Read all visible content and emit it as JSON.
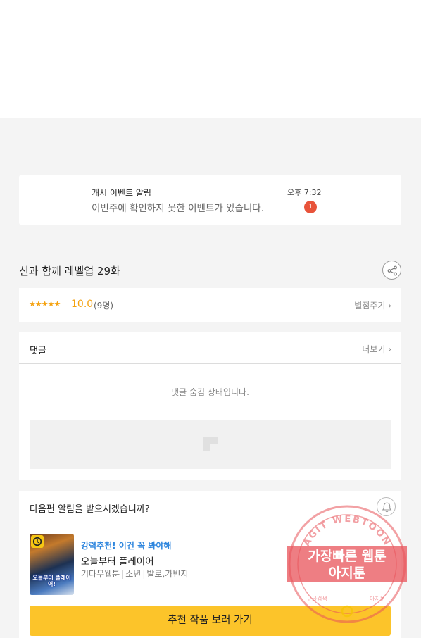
{
  "notification": {
    "title": "캐시 이벤트 알림",
    "body": "이번주에 확인하지 못한 이벤트가 있습니다.",
    "time": "오후 7:32",
    "badge": "1"
  },
  "episode": {
    "title": "신과 함께 레벨업 29화",
    "share_icon": "share-icon"
  },
  "rating": {
    "stars": "★★★★★",
    "score": "10.0",
    "count": "(9명)",
    "rate_link": "별점주기 ›"
  },
  "comments": {
    "title": "댓글",
    "more": "더보기 ›",
    "hidden_message": "댓글 숨김 상태입니다."
  },
  "next_alert": {
    "question": "다음편 알림을 받으시겠습니까?",
    "bell_icon": "bell-icon",
    "thumbnail_text": "오늘부터 플레이어!",
    "tag": "강력추천! 이건 꼭 봐야해",
    "title": "오늘부터 플레이어",
    "genres": [
      "기다무웹툰",
      "소년",
      "발로,가빈지"
    ],
    "cta": "추천 작품 보러 가기"
  },
  "watermark": {
    "top_text": "AGIT WEBTOON",
    "line1": "가장빠른 웹툰",
    "line2": "아지툰",
    "bottom_left": "구글검색",
    "bottom_right": "아지툰",
    "color": "#e8535a"
  }
}
